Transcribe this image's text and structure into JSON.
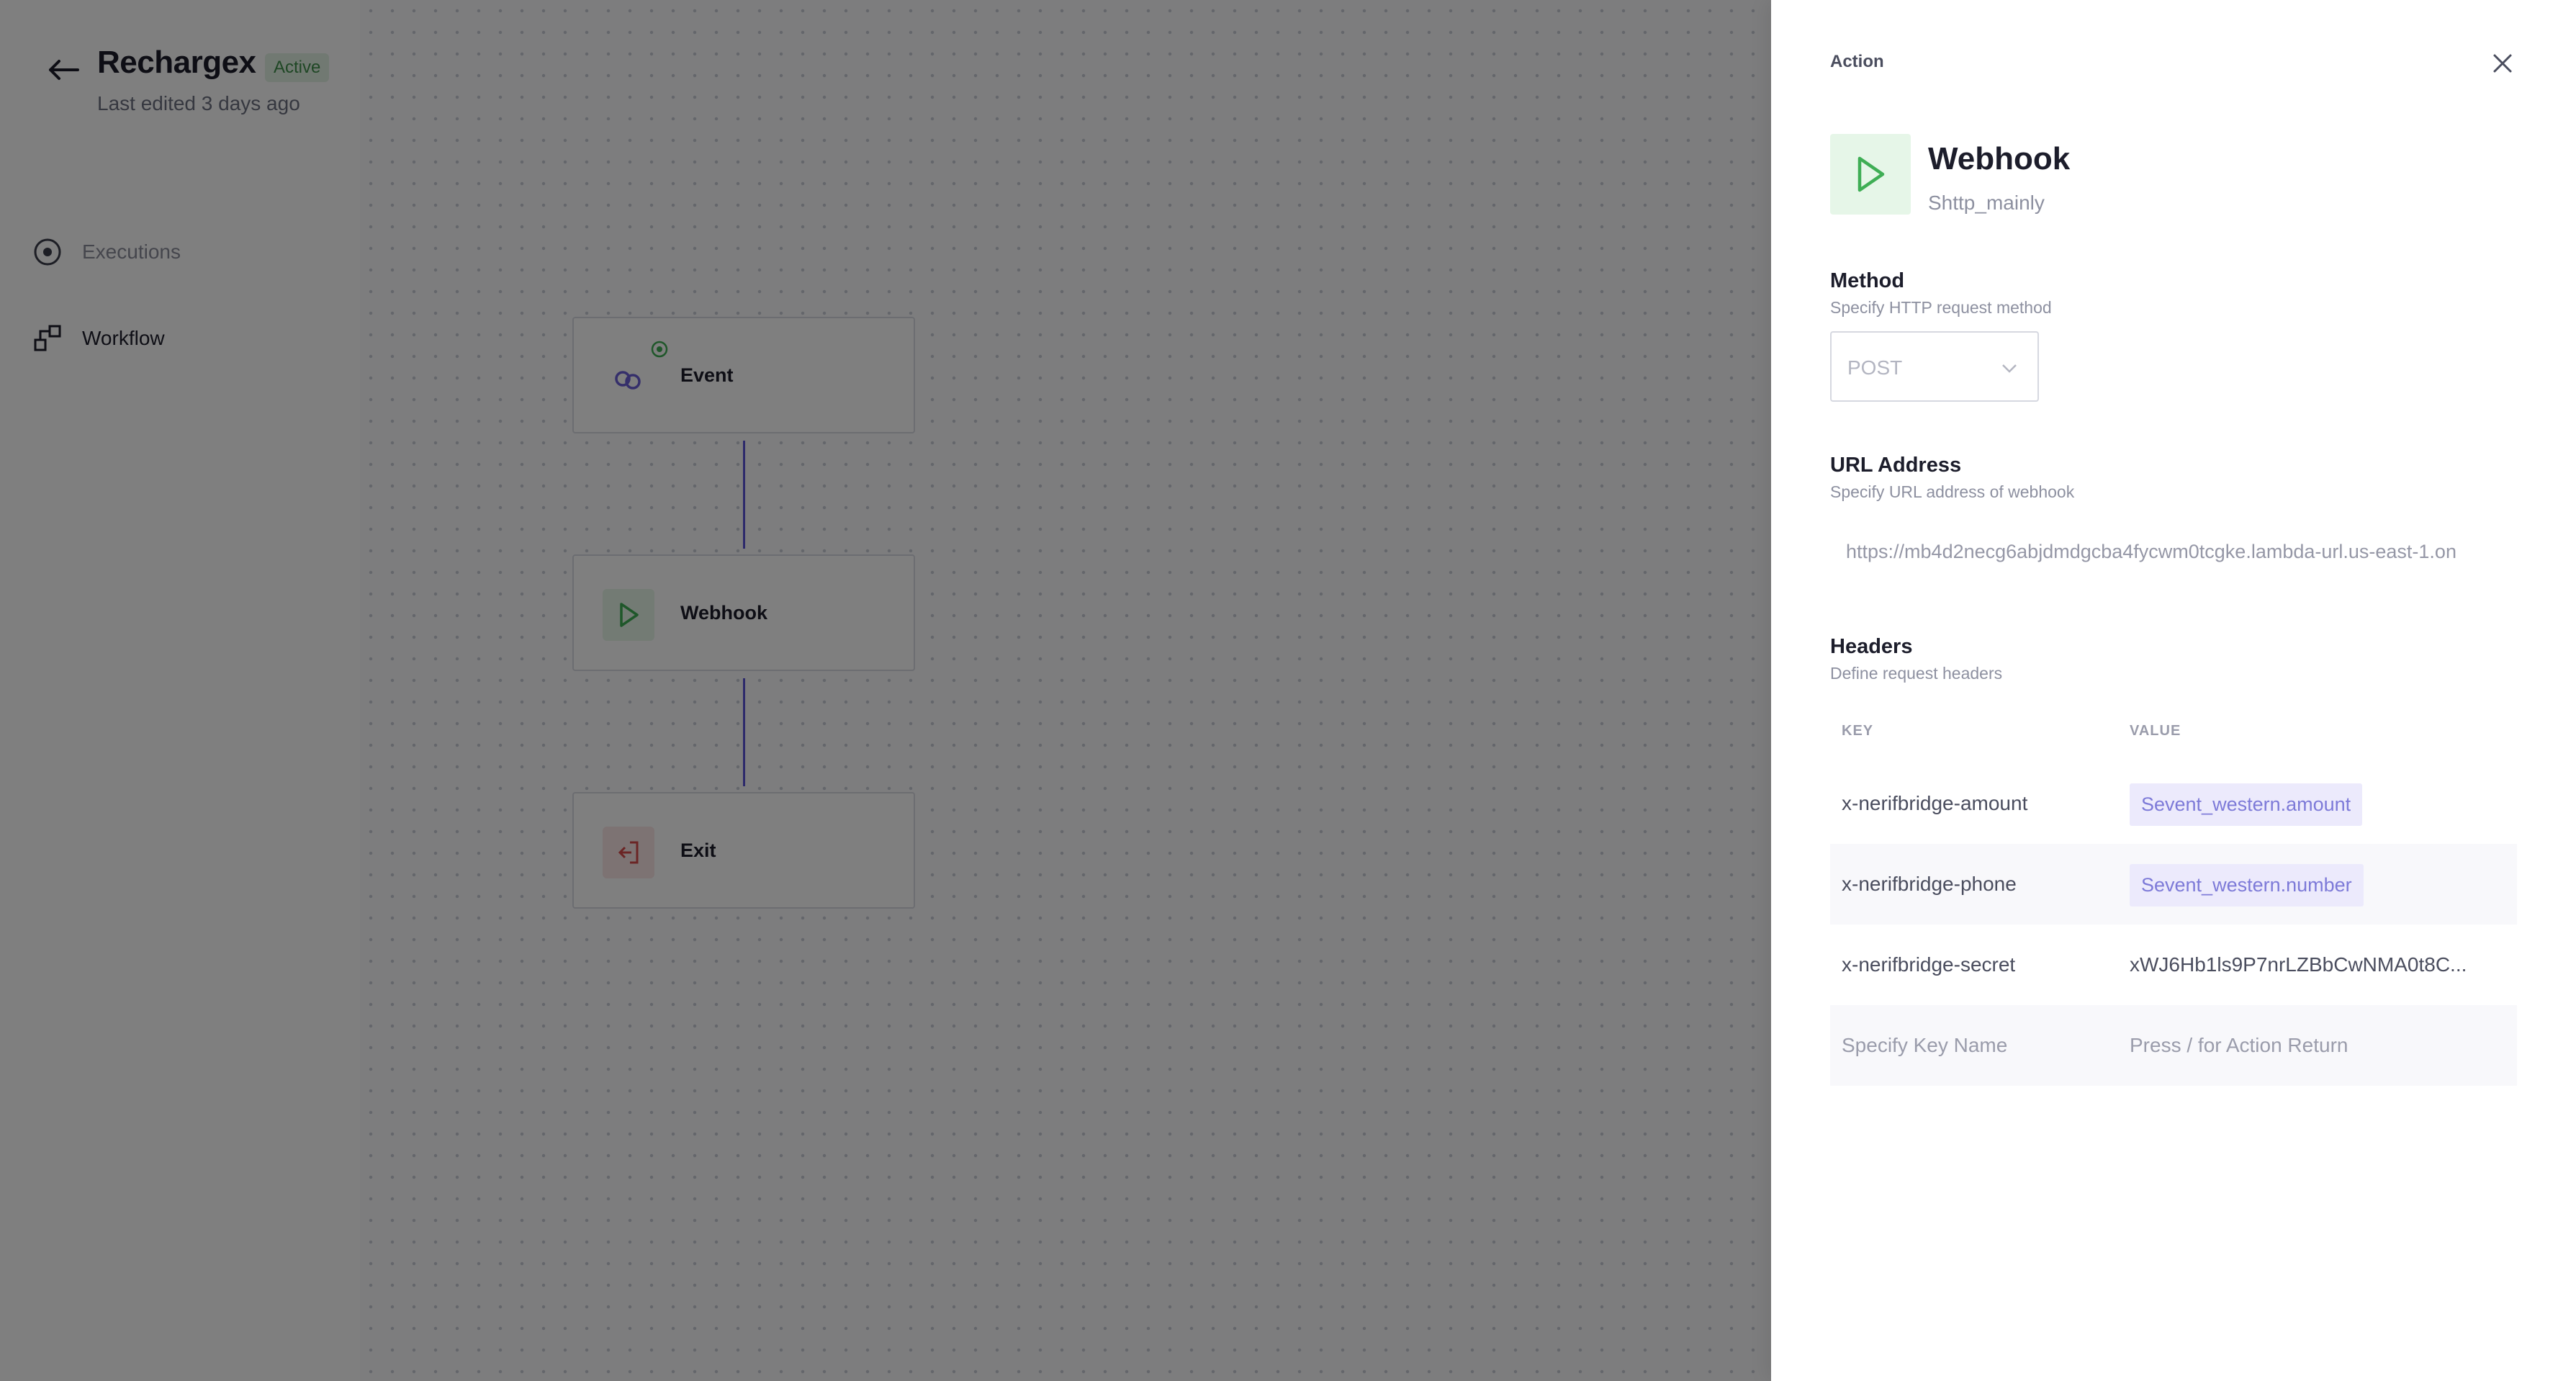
{
  "app": {
    "title": "Rechargex",
    "status": "Active",
    "last_edited": "Last edited 3 days ago"
  },
  "nav": [
    {
      "label": "Executions",
      "icon": "target-icon"
    },
    {
      "label": "Workflow",
      "icon": "workflow-icon"
    }
  ],
  "workflow": {
    "nodes": [
      {
        "label": "Event",
        "icon": "link-icon",
        "accent": "#6b5fd6"
      },
      {
        "label": "Webhook",
        "icon": "play-icon",
        "accent": "#3fae55"
      },
      {
        "label": "Exit",
        "icon": "exit-icon",
        "accent": "#d64b4b"
      }
    ]
  },
  "drawer": {
    "label": "Action",
    "action_title": "Webhook",
    "action_subtitle": "Shttp_mainly",
    "method": {
      "title": "Method",
      "description": "Specify HTTP request method",
      "value": "POST"
    },
    "url": {
      "title": "URL Address",
      "description": "Specify URL address of webhook",
      "value": "https://mb4d2necg6abjdmdgcba4fycwm0tcgke.lambda-url.us-east-1.on"
    },
    "headers": {
      "title": "Headers",
      "description": "Define request headers",
      "col_key": "KEY",
      "col_value": "VALUE",
      "rows": [
        {
          "key": "x-nerifbridge-amount",
          "value": "Sevent_western.amount"
        },
        {
          "key": "x-nerifbridge-phone",
          "value": "Sevent_western.number"
        },
        {
          "key": "x-nerifbridge-secret",
          "value": "xWJ6Hb1ls9P7nrLZBbCwNMA0t8C..."
        }
      ],
      "new_key_placeholder": "Specify Key Name",
      "new_value_placeholder": "Press / for Action Return"
    }
  },
  "colors": {
    "accent": "#5a54d6",
    "success": "#3fae55",
    "danger": "#d64b4b"
  }
}
